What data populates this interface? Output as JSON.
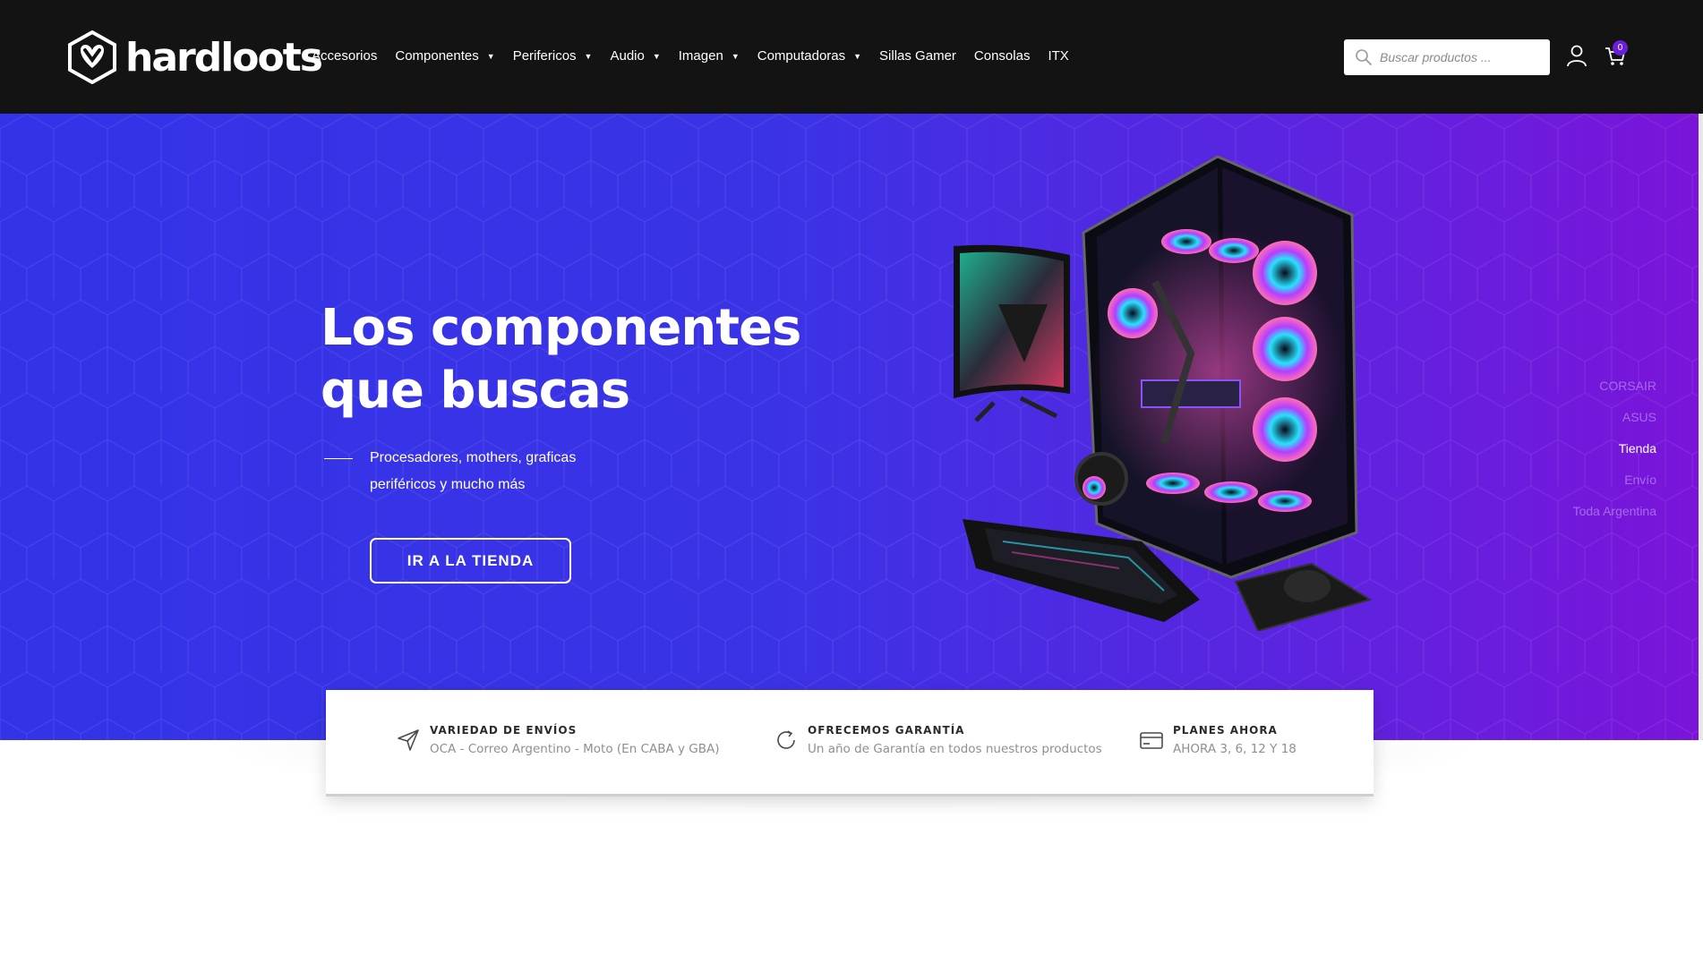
{
  "brand": {
    "name": "hardloots"
  },
  "nav": {
    "items": [
      {
        "label": "Accesorios",
        "has_dropdown": false
      },
      {
        "label": "Componentes",
        "has_dropdown": true
      },
      {
        "label": "Perifericos",
        "has_dropdown": true
      },
      {
        "label": "Audio",
        "has_dropdown": true
      },
      {
        "label": "Imagen",
        "has_dropdown": true
      },
      {
        "label": "Computadoras",
        "has_dropdown": true
      },
      {
        "label": "Sillas Gamer",
        "has_dropdown": false
      },
      {
        "label": "Consolas",
        "has_dropdown": false
      },
      {
        "label": "ITX",
        "has_dropdown": false
      }
    ],
    "caret": "▼"
  },
  "search": {
    "placeholder": "Buscar productos ...",
    "value": ""
  },
  "header_icons": {
    "user": "user-icon",
    "cart": "cart-icon"
  },
  "cart": {
    "count": "0"
  },
  "hero": {
    "title_line1": "Los componentes",
    "title_line2": "que buscas",
    "subtitle_line1": "Procesadores, mothers, graficas",
    "subtitle_line2": "periféricos y mucho más",
    "cta_label": "IR A LA TIENDA"
  },
  "side_nav": {
    "items": [
      {
        "label": "CORSAIR",
        "active": false
      },
      {
        "label": "ASUS",
        "active": false
      },
      {
        "label": "Tienda",
        "active": true
      },
      {
        "label": "Envío",
        "active": false
      },
      {
        "label": "Toda Argentina",
        "active": false
      }
    ]
  },
  "features": [
    {
      "icon": "send-icon",
      "title": "VARIEDAD DE ENVÍOS",
      "text": "OCA - Correo Argentino - Moto (En CABA y GBA)"
    },
    {
      "icon": "refresh-icon",
      "title": "OFRECEMOS GARANTÍA",
      "text": "Un año de Garantía en todos nuestros productos"
    },
    {
      "icon": "credit-card-icon",
      "title": "PLANES AHORA",
      "text": "AHORA 3, 6, 12 Y 18"
    }
  ],
  "colors": {
    "header_bg": "#131313",
    "hero_gradient_start": "#3433e8",
    "hero_gradient_end": "#7b14d9",
    "accent": "#6a1fd8"
  }
}
